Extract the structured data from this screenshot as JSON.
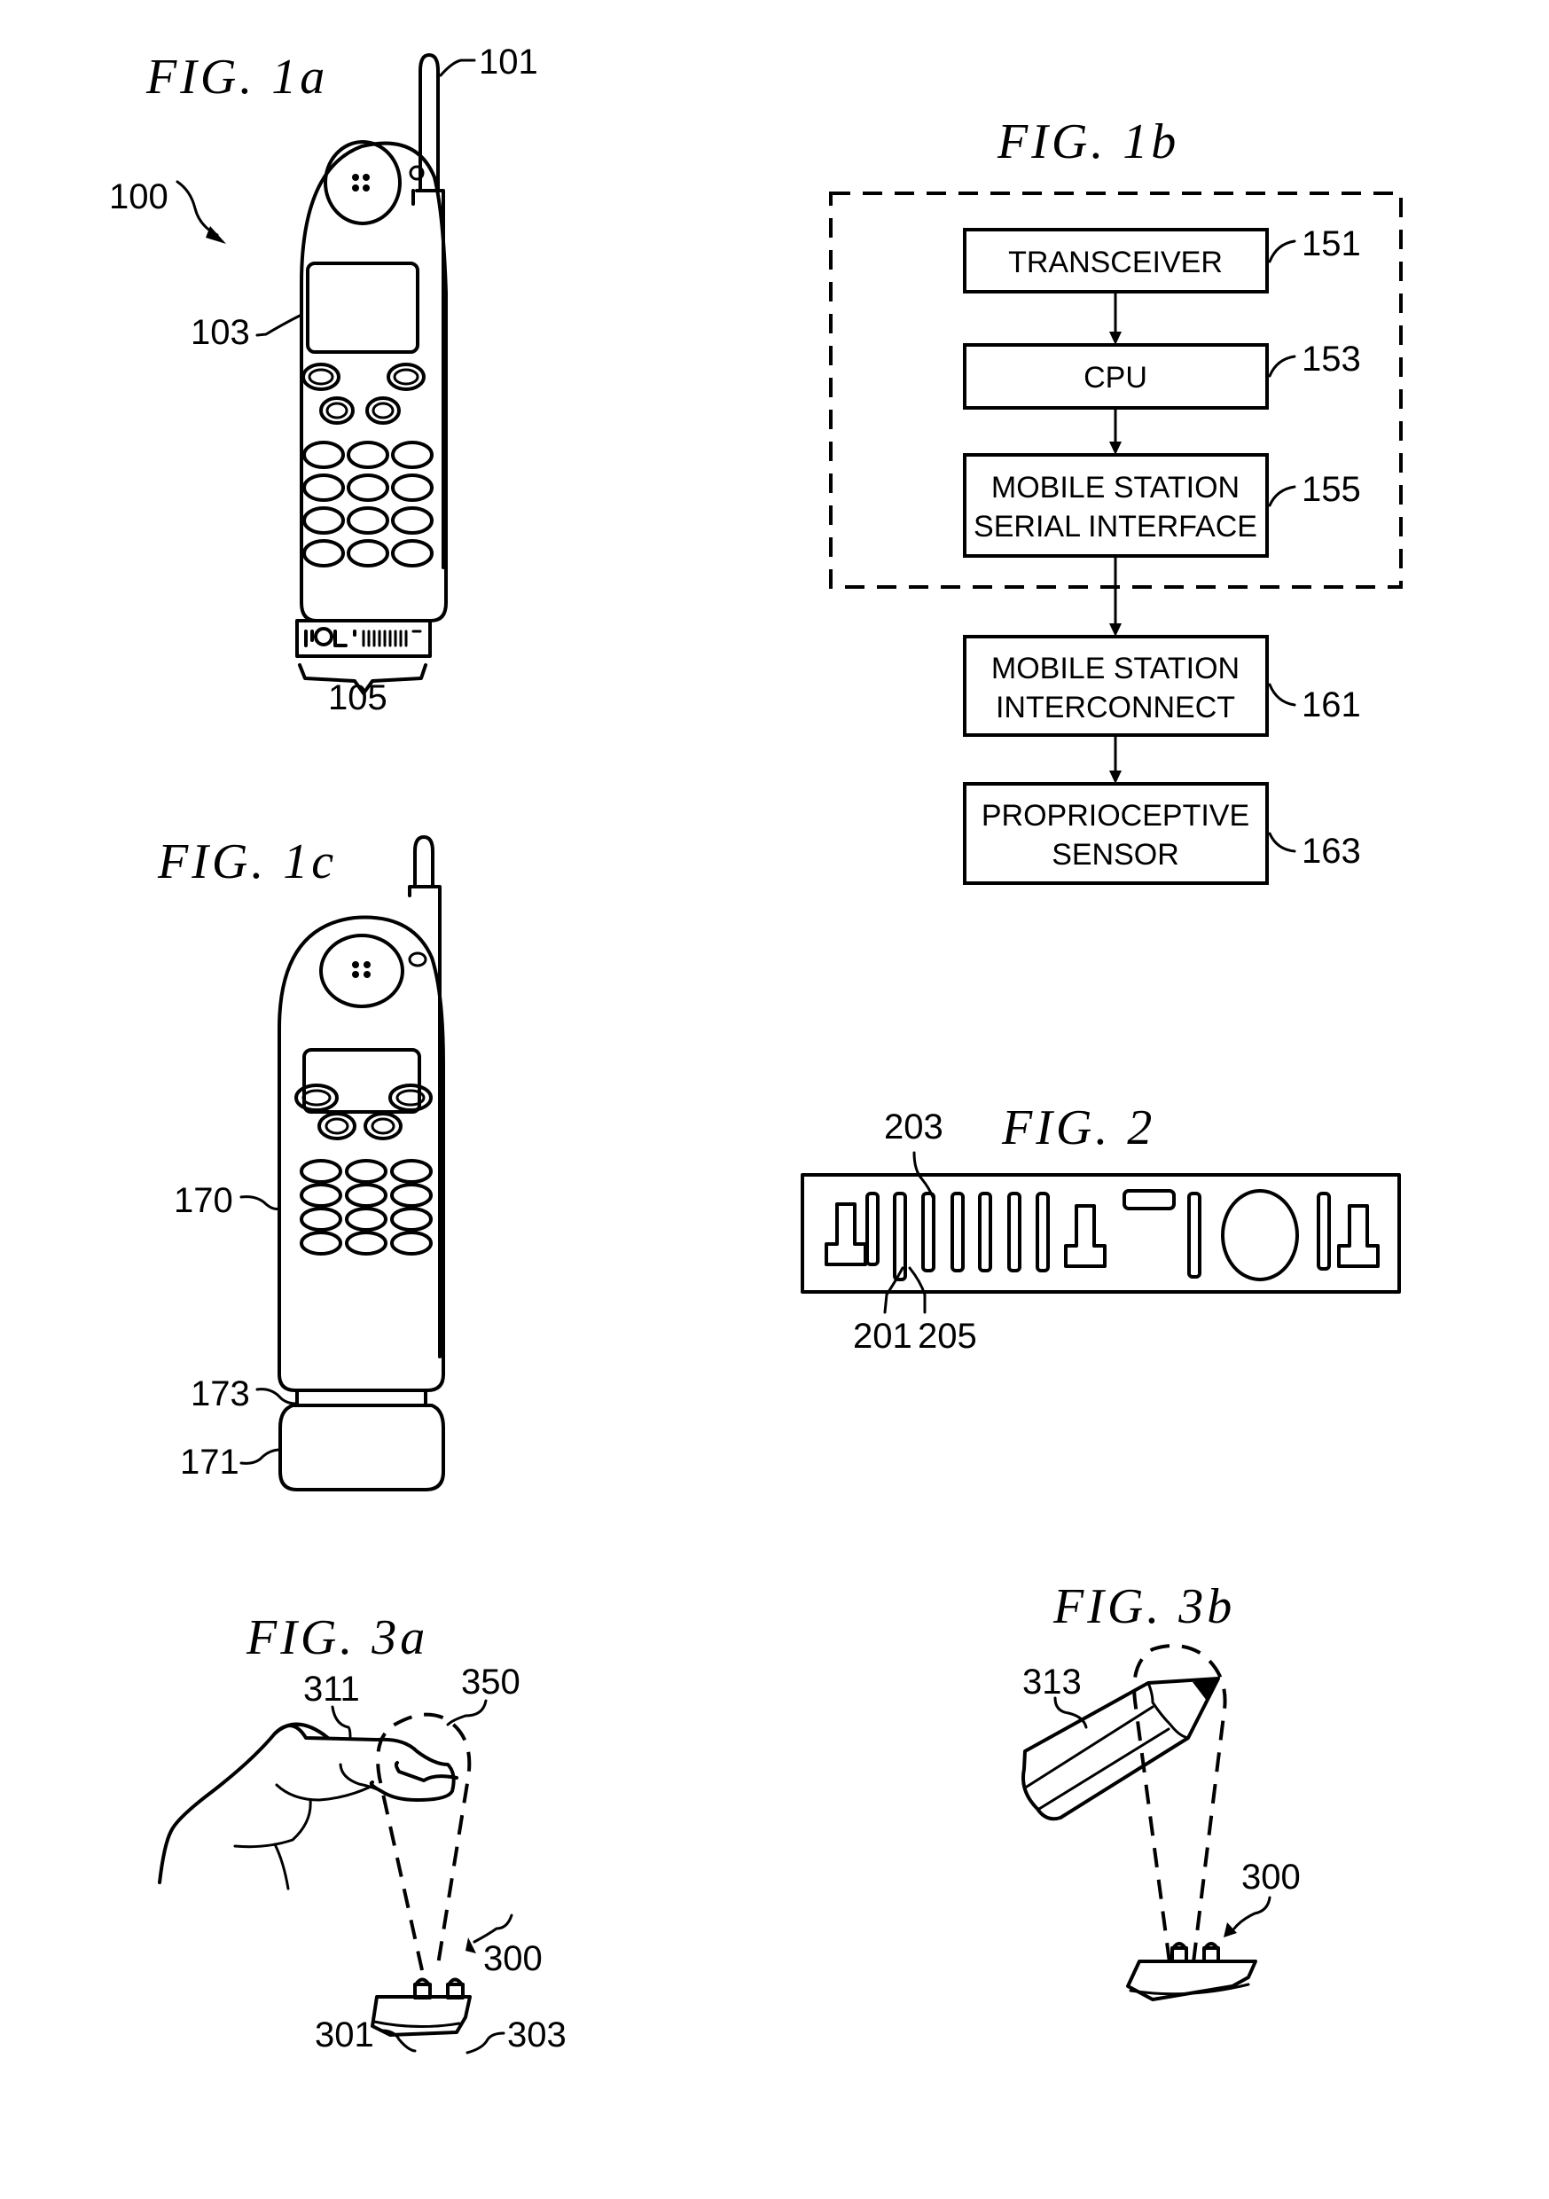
{
  "figures": {
    "fig1a": {
      "title": "FIG. 1a",
      "refs": {
        "antenna": "101",
        "phone": "100",
        "display": "103",
        "connector": "105"
      }
    },
    "fig1b": {
      "title": "FIG. 1b",
      "blocks": [
        {
          "lines": [
            "TRANSCEIVER"
          ],
          "ref": "151"
        },
        {
          "lines": [
            "CPU"
          ],
          "ref": "153"
        },
        {
          "lines": [
            "MOBILE STATION",
            "SERIAL INTERFACE"
          ],
          "ref": "155"
        },
        {
          "lines": [
            "MOBILE STATION",
            "INTERCONNECT"
          ],
          "ref": "161"
        },
        {
          "lines": [
            "PROPRIOCEPTIVE",
            "SENSOR"
          ],
          "ref": "163"
        }
      ]
    },
    "fig1c": {
      "title": "FIG. 1c",
      "refs": {
        "phone": "170",
        "joint": "173",
        "sensor_module": "171"
      }
    },
    "fig2": {
      "title": "FIG. 2",
      "refs": {
        "pin_a": "203",
        "pin_b": "201",
        "pin_c": "205"
      }
    },
    "fig3a": {
      "title": "FIG. 3a",
      "refs": {
        "finger": "311",
        "field": "350",
        "sensor": "300",
        "emitter": "301",
        "detector": "303"
      }
    },
    "fig3b": {
      "title": "FIG. 3b",
      "refs": {
        "pencil": "313",
        "sensor": "300"
      }
    }
  }
}
